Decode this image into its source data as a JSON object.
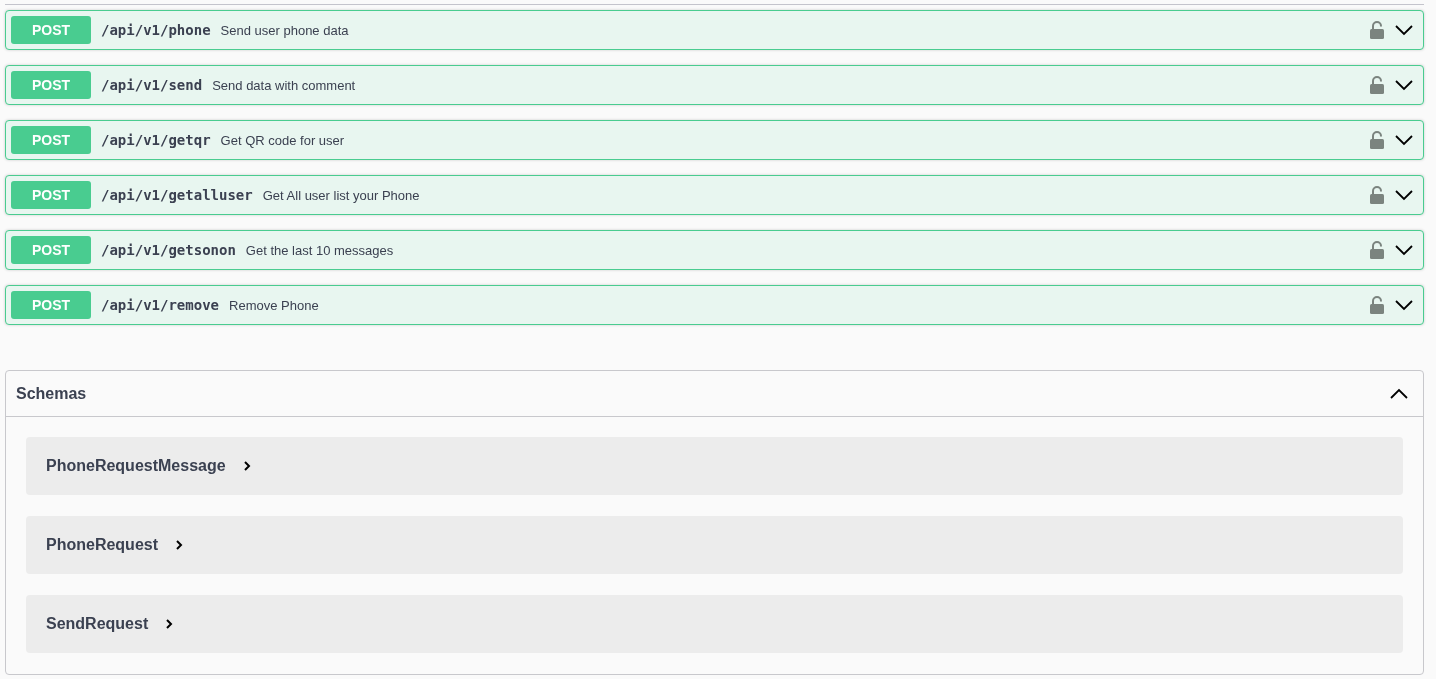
{
  "operations": [
    {
      "method": "POST",
      "path": "/api/v1/phone",
      "summary": "Send user phone data",
      "locked": false,
      "expanded": false
    },
    {
      "method": "POST",
      "path": "/api/v1/send",
      "summary": "Send data with comment",
      "locked": false,
      "expanded": false
    },
    {
      "method": "POST",
      "path": "/api/v1/getqr",
      "summary": "Get QR code for user",
      "locked": false,
      "expanded": false
    },
    {
      "method": "POST",
      "path": "/api/v1/getalluser",
      "summary": "Get All user list your Phone",
      "locked": false,
      "expanded": false
    },
    {
      "method": "POST",
      "path": "/api/v1/getsonon",
      "summary": "Get the last 10 messages",
      "locked": false,
      "expanded": false
    },
    {
      "method": "POST",
      "path": "/api/v1/remove",
      "summary": "Remove Phone",
      "locked": false,
      "expanded": false
    }
  ],
  "schemas": {
    "title": "Schemas",
    "expanded": true,
    "items": [
      {
        "name": "PhoneRequestMessage",
        "expanded": false
      },
      {
        "name": "PhoneRequest",
        "expanded": false
      },
      {
        "name": "SendRequest",
        "expanded": false
      }
    ]
  }
}
